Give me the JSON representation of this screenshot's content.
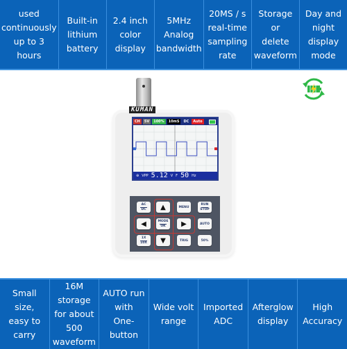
{
  "top_features": [
    {
      "label": "used\ncontinuously\nup to 3 hours"
    },
    {
      "label": "Built-in\nlithium\nbattery"
    },
    {
      "label": "2.4 inch\ncolor display"
    },
    {
      "label": "5MHz\nAnalog\nbandwidth"
    },
    {
      "label": "20MS / s\nreal-time\nsampling\nrate"
    },
    {
      "label": "Storage or\ndelete\nwaveform"
    },
    {
      "label": "Day and\nnight display\nmode"
    }
  ],
  "bottom_features": [
    {
      "label": "Small size,\neasy to carry"
    },
    {
      "label": "16M storage\nfor about 500\nwaveform"
    },
    {
      "label": "AUTO run\nwith\nOne-button"
    },
    {
      "label": "Wide volt\nrange"
    },
    {
      "label": "Imported\nADC"
    },
    {
      "label": "Afterglow\ndisplay"
    },
    {
      "label": "High\nAccuracy"
    }
  ],
  "colors": {
    "bar_blue": "#0b63b8",
    "divider": "#3a8fdf",
    "dpad_outline": "#c33a34",
    "charge_green": "#2fb847",
    "charge_bolt": "#f4d21f",
    "waveform": "#3b4fbf"
  },
  "device": {
    "brand": "KUMAN",
    "screen": {
      "status": {
        "channel": "CH",
        "volts_div": "5V",
        "position": "100%",
        "time_div": "10mS",
        "coupling": "DC",
        "mode": "Auto"
      },
      "readout": {
        "label": "VPP",
        "value": "5.12",
        "unit": "V",
        "freq_label": "F",
        "freq_value": "50",
        "freq_unit": "Hz"
      },
      "waveform": {
        "type": "square",
        "periods_visible": 4
      }
    },
    "keys": {
      "ac_dc": [
        "AC",
        "DC"
      ],
      "up": "▲",
      "menu": "MENU",
      "run_stop": [
        "RUN",
        "STOP"
      ],
      "left": "◀",
      "mode_ok": [
        "MODE",
        "OK"
      ],
      "right": "▶",
      "auto": "AUTO",
      "probe": [
        "1X",
        "10X"
      ],
      "down": "▼",
      "trig": "TRIG",
      "fifty": "50%"
    }
  }
}
